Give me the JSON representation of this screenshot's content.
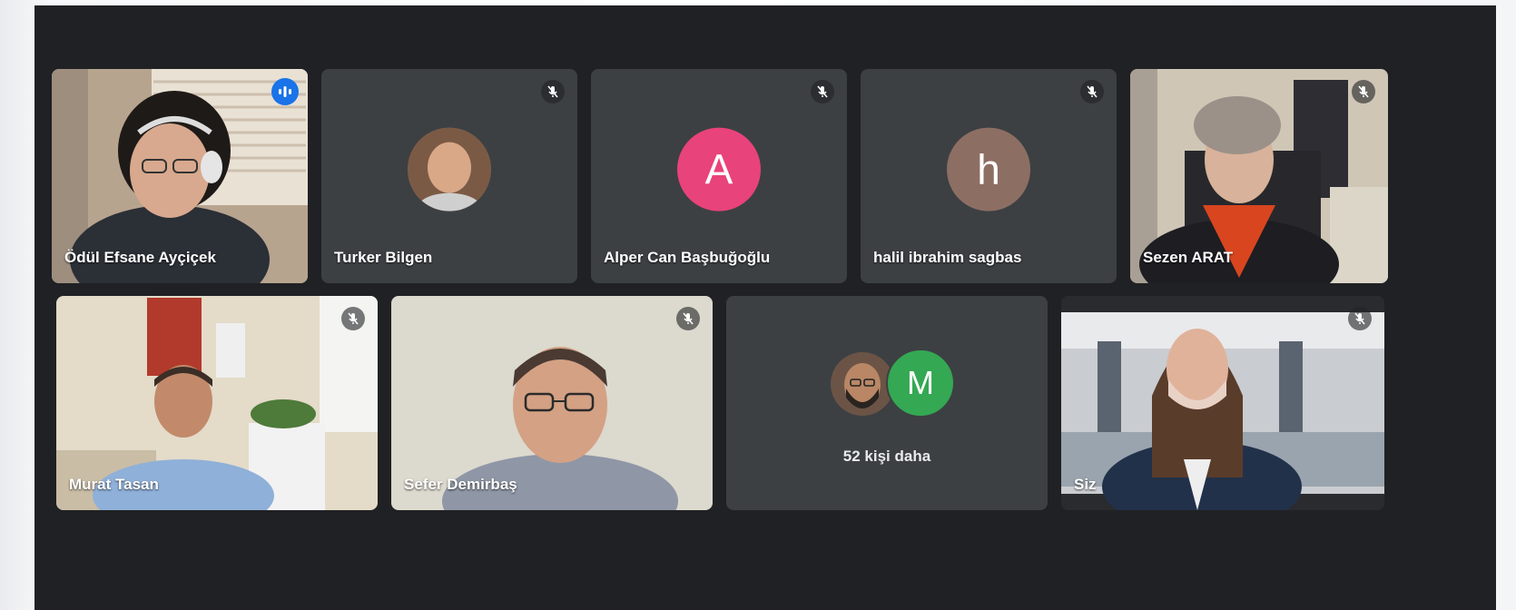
{
  "participants_row1": [
    {
      "name": "Ödül Efsane Ayçiçek",
      "status": "speaking"
    },
    {
      "name": "Turker Bilgen",
      "status": "muted"
    },
    {
      "name": "Alper Can Başbuğoğlu",
      "status": "muted",
      "initial": "A",
      "avatar_color": "#e8437a"
    },
    {
      "name": "halil ibrahim sagbas",
      "status": "muted",
      "initial": "h",
      "avatar_color": "#8d6e63"
    },
    {
      "name": "Sezen ARAT",
      "status": "muted"
    }
  ],
  "participants_row2": [
    {
      "name": "Murat Tasan",
      "status": "muted"
    },
    {
      "name": "Sefer Demirbaş",
      "status": "muted"
    },
    {
      "name": "Siz",
      "status": "muted"
    }
  ],
  "more": {
    "label": "52 kişi daha",
    "initial": "M",
    "avatar_color": "#34a853"
  },
  "colors": {
    "background": "#202124",
    "tile": "#3c4043",
    "active_speaker": "#8ab4f8",
    "accent": "#1a73e8"
  }
}
